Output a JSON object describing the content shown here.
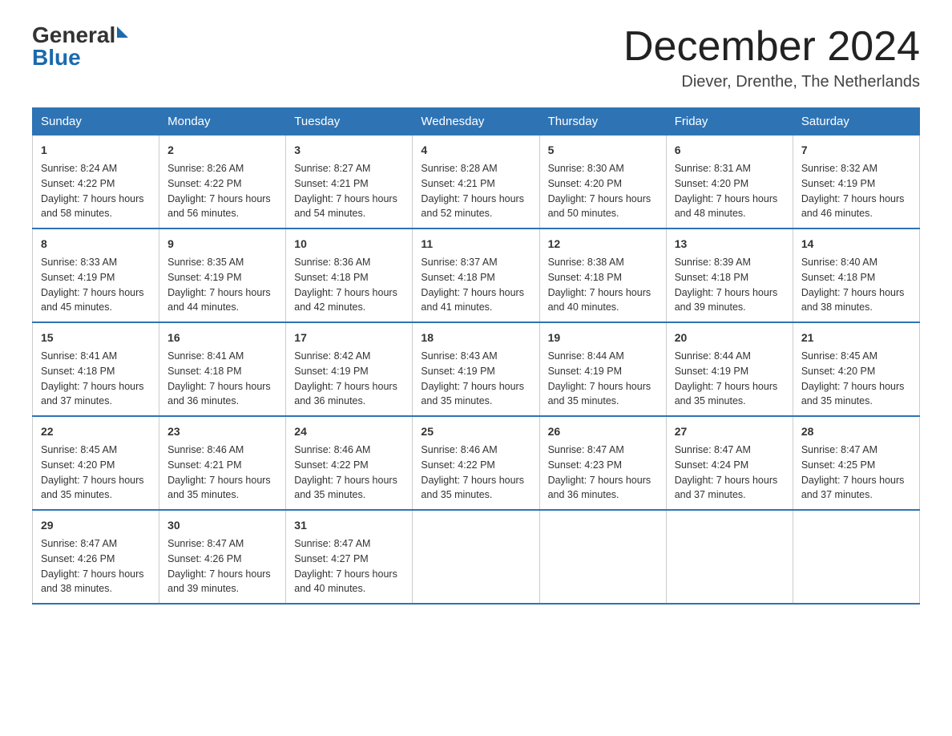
{
  "header": {
    "logo_line1": "General",
    "logo_line2": "Blue",
    "month_title": "December 2024",
    "location": "Diever, Drenthe, The Netherlands"
  },
  "weekdays": [
    "Sunday",
    "Monday",
    "Tuesday",
    "Wednesday",
    "Thursday",
    "Friday",
    "Saturday"
  ],
  "weeks": [
    [
      {
        "day": "1",
        "sunrise": "8:24 AM",
        "sunset": "4:22 PM",
        "daylight": "7 hours and 58 minutes."
      },
      {
        "day": "2",
        "sunrise": "8:26 AM",
        "sunset": "4:22 PM",
        "daylight": "7 hours and 56 minutes."
      },
      {
        "day": "3",
        "sunrise": "8:27 AM",
        "sunset": "4:21 PM",
        "daylight": "7 hours and 54 minutes."
      },
      {
        "day": "4",
        "sunrise": "8:28 AM",
        "sunset": "4:21 PM",
        "daylight": "7 hours and 52 minutes."
      },
      {
        "day": "5",
        "sunrise": "8:30 AM",
        "sunset": "4:20 PM",
        "daylight": "7 hours and 50 minutes."
      },
      {
        "day": "6",
        "sunrise": "8:31 AM",
        "sunset": "4:20 PM",
        "daylight": "7 hours and 48 minutes."
      },
      {
        "day": "7",
        "sunrise": "8:32 AM",
        "sunset": "4:19 PM",
        "daylight": "7 hours and 46 minutes."
      }
    ],
    [
      {
        "day": "8",
        "sunrise": "8:33 AM",
        "sunset": "4:19 PM",
        "daylight": "7 hours and 45 minutes."
      },
      {
        "day": "9",
        "sunrise": "8:35 AM",
        "sunset": "4:19 PM",
        "daylight": "7 hours and 44 minutes."
      },
      {
        "day": "10",
        "sunrise": "8:36 AM",
        "sunset": "4:18 PM",
        "daylight": "7 hours and 42 minutes."
      },
      {
        "day": "11",
        "sunrise": "8:37 AM",
        "sunset": "4:18 PM",
        "daylight": "7 hours and 41 minutes."
      },
      {
        "day": "12",
        "sunrise": "8:38 AM",
        "sunset": "4:18 PM",
        "daylight": "7 hours and 40 minutes."
      },
      {
        "day": "13",
        "sunrise": "8:39 AM",
        "sunset": "4:18 PM",
        "daylight": "7 hours and 39 minutes."
      },
      {
        "day": "14",
        "sunrise": "8:40 AM",
        "sunset": "4:18 PM",
        "daylight": "7 hours and 38 minutes."
      }
    ],
    [
      {
        "day": "15",
        "sunrise": "8:41 AM",
        "sunset": "4:18 PM",
        "daylight": "7 hours and 37 minutes."
      },
      {
        "day": "16",
        "sunrise": "8:41 AM",
        "sunset": "4:18 PM",
        "daylight": "7 hours and 36 minutes."
      },
      {
        "day": "17",
        "sunrise": "8:42 AM",
        "sunset": "4:19 PM",
        "daylight": "7 hours and 36 minutes."
      },
      {
        "day": "18",
        "sunrise": "8:43 AM",
        "sunset": "4:19 PM",
        "daylight": "7 hours and 35 minutes."
      },
      {
        "day": "19",
        "sunrise": "8:44 AM",
        "sunset": "4:19 PM",
        "daylight": "7 hours and 35 minutes."
      },
      {
        "day": "20",
        "sunrise": "8:44 AM",
        "sunset": "4:19 PM",
        "daylight": "7 hours and 35 minutes."
      },
      {
        "day": "21",
        "sunrise": "8:45 AM",
        "sunset": "4:20 PM",
        "daylight": "7 hours and 35 minutes."
      }
    ],
    [
      {
        "day": "22",
        "sunrise": "8:45 AM",
        "sunset": "4:20 PM",
        "daylight": "7 hours and 35 minutes."
      },
      {
        "day": "23",
        "sunrise": "8:46 AM",
        "sunset": "4:21 PM",
        "daylight": "7 hours and 35 minutes."
      },
      {
        "day": "24",
        "sunrise": "8:46 AM",
        "sunset": "4:22 PM",
        "daylight": "7 hours and 35 minutes."
      },
      {
        "day": "25",
        "sunrise": "8:46 AM",
        "sunset": "4:22 PM",
        "daylight": "7 hours and 35 minutes."
      },
      {
        "day": "26",
        "sunrise": "8:47 AM",
        "sunset": "4:23 PM",
        "daylight": "7 hours and 36 minutes."
      },
      {
        "day": "27",
        "sunrise": "8:47 AM",
        "sunset": "4:24 PM",
        "daylight": "7 hours and 37 minutes."
      },
      {
        "day": "28",
        "sunrise": "8:47 AM",
        "sunset": "4:25 PM",
        "daylight": "7 hours and 37 minutes."
      }
    ],
    [
      {
        "day": "29",
        "sunrise": "8:47 AM",
        "sunset": "4:26 PM",
        "daylight": "7 hours and 38 minutes."
      },
      {
        "day": "30",
        "sunrise": "8:47 AM",
        "sunset": "4:26 PM",
        "daylight": "7 hours and 39 minutes."
      },
      {
        "day": "31",
        "sunrise": "8:47 AM",
        "sunset": "4:27 PM",
        "daylight": "7 hours and 40 minutes."
      },
      null,
      null,
      null,
      null
    ]
  ]
}
